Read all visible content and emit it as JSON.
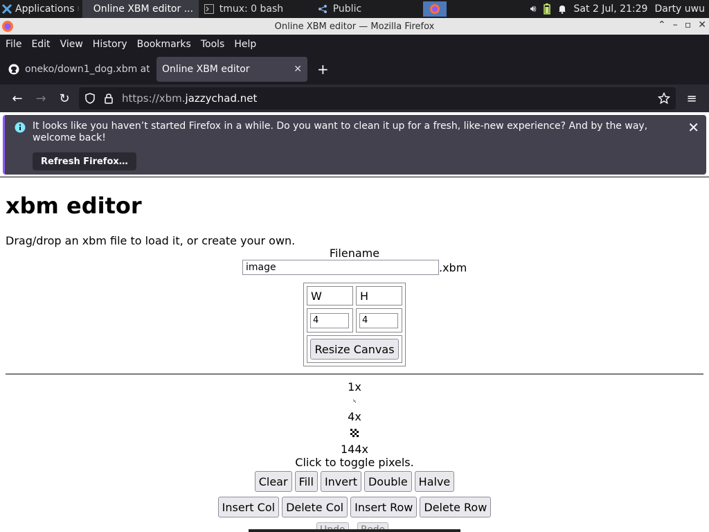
{
  "panel": {
    "applications_label": "Applications",
    "tasks": [
      {
        "label": "Online XBM editor ..."
      },
      {
        "label": "tmux: 0 bash"
      },
      {
        "label": "Public"
      }
    ],
    "datetime": "Sat  2 Jul, 21:29",
    "user": "Darty uwu"
  },
  "window": {
    "title": "Online XBM editor — Mozilla Firefox"
  },
  "menubar": {
    "items": [
      "File",
      "Edit",
      "View",
      "History",
      "Bookmarks",
      "Tools",
      "Help"
    ]
  },
  "tabs": [
    {
      "title": "oneko/down1_dog.xbm at",
      "icon": "github-icon"
    },
    {
      "title": "Online XBM editor",
      "icon": "none"
    }
  ],
  "navbar": {
    "url_scheme": "https://xbm.",
    "url_host": "jazzychad.net"
  },
  "notification": {
    "message": "It looks like you haven’t started Firefox in a while. Do you want to clean it up for a fresh, like-new experience? And by the way, welcome back!",
    "button_label": "Refresh Firefox…"
  },
  "page": {
    "heading": "xbm editor",
    "intro": "Drag/drop an xbm file to load it, or create your own.",
    "filename_label": "Filename",
    "filename_value": "image",
    "filename_ext": ".xbm",
    "width_label": "W",
    "height_label": "H",
    "width_value": "4",
    "height_value": "4",
    "resize_label": "Resize Canvas",
    "zoom_1x": "1x",
    "zoom_4x": "4x",
    "zoom_144x": "144x",
    "toggle_hint": "Click to toggle pixels.",
    "row1_buttons": [
      "Clear",
      "Fill",
      "Invert",
      "Double",
      "Halve"
    ],
    "row2_buttons": [
      "Insert Col",
      "Delete Col",
      "Insert Row",
      "Delete Row"
    ],
    "row3_buttons": [
      "Undo",
      "Redo"
    ]
  },
  "colors": {
    "panel_bg": "#1d1d20",
    "firefox_dark": "#1c1b22",
    "notification_bg": "#42414d",
    "accent_purple": "#9059ff"
  }
}
